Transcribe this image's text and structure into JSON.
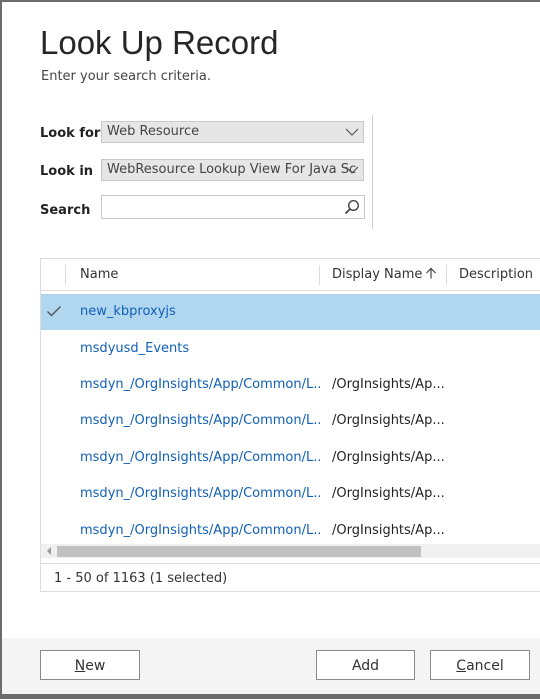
{
  "dialog": {
    "title": "Look Up Record",
    "subtitle": "Enter your search criteria."
  },
  "form": {
    "look_for_label": "Look for",
    "look_for_value": "Web Resource",
    "look_in_label": "Look in",
    "look_in_value": "WebResource Lookup View For Java Sc",
    "search_label": "Search",
    "search_value": ""
  },
  "grid": {
    "columns": [
      "Name",
      "Display Name",
      "Description"
    ],
    "sorted_column": "Display Name",
    "sort_direction": "ascending",
    "rows": [
      {
        "name": "new_kbproxyjs",
        "display_name": "",
        "selected": true
      },
      {
        "name": "msdyusd_Events",
        "display_name": "",
        "selected": false
      },
      {
        "name": "msdyn_/OrgInsights/App/Common/L...",
        "display_name": "/OrgInsights/Ap...",
        "selected": false
      },
      {
        "name": "msdyn_/OrgInsights/App/Common/L...",
        "display_name": "/OrgInsights/Ap...",
        "selected": false
      },
      {
        "name": "msdyn_/OrgInsights/App/Common/L...",
        "display_name": "/OrgInsights/Ap...",
        "selected": false
      },
      {
        "name": "msdyn_/OrgInsights/App/Common/L...",
        "display_name": "/OrgInsights/Ap...",
        "selected": false
      },
      {
        "name": "msdyn_/OrgInsights/App/Common/L...",
        "display_name": "/OrgInsights/Ap...",
        "selected": false
      }
    ],
    "status": "1 - 50 of 1163 (1 selected)"
  },
  "buttons": {
    "new_first": "N",
    "new_rest": "ew",
    "add": "Add",
    "cancel_first": "C",
    "cancel_rest": "ancel"
  },
  "colors": {
    "selected_row": "#b1d6f0",
    "link": "#1160b7"
  }
}
